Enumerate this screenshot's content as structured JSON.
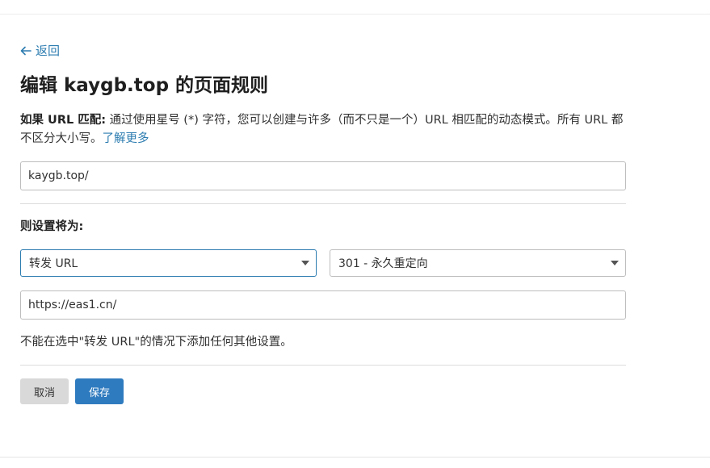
{
  "nav": {
    "back_label": "返回"
  },
  "page": {
    "title": "编辑 kaygb.top 的页面规则"
  },
  "match": {
    "label": "如果 URL 匹配:",
    "description": " 通过使用星号 (*) 字符，您可以创建与许多（而不只是一个）URL 相匹配的动态模式。所有 URL 都不区分大小写。",
    "learn_more": "了解更多",
    "url_value": "kaygb.top/"
  },
  "settings": {
    "label": "则设置将为:",
    "setting_selected": "转发 URL",
    "status_selected": "301 - 永久重定向",
    "destination_value": "https://eas1.cn/",
    "note": "不能在选中\"转发 URL\"的情况下添加任何其他设置。"
  },
  "actions": {
    "cancel_label": "取消",
    "save_label": "保存"
  },
  "colors": {
    "link": "#2c7cb0",
    "primary_button": "#2f7bbf",
    "secondary_button": "#d9d9d9"
  },
  "icons": {
    "back": "arrow-left-icon",
    "dropdown": "caret-down-icon"
  }
}
